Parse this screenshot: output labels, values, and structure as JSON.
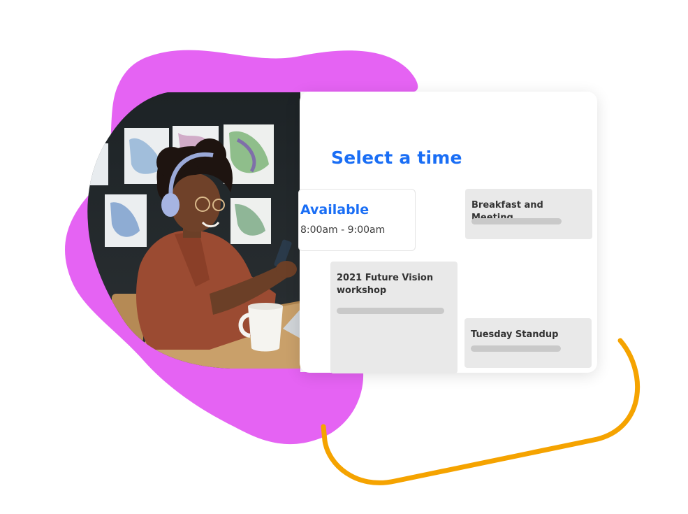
{
  "colors": {
    "blob": "#e563f3",
    "accent_line": "#f5a300",
    "primary_text": "#1a6ef5",
    "event_bg": "#e9e9e9"
  },
  "scheduler": {
    "title": "Select a time",
    "available": {
      "label": "Available",
      "time": "8:00am - 9:00am"
    },
    "events": [
      {
        "title": "Breakfast and Meeting"
      },
      {
        "title": "2021 Future Vision workshop"
      },
      {
        "title": "Tuesday Standup"
      }
    ]
  },
  "photo": {
    "subject": "woman-with-headphones-using-phone-icon"
  }
}
